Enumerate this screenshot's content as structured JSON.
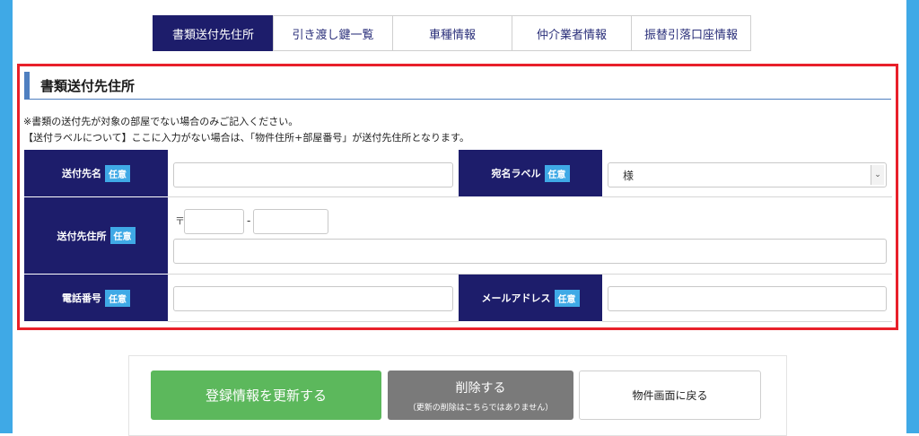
{
  "tabs": [
    {
      "label": "書類送付先住所"
    },
    {
      "label": "引き渡し鍵一覧"
    },
    {
      "label": "車種情報"
    },
    {
      "label": "仲介業者情報"
    },
    {
      "label": "振替引落口座情報"
    }
  ],
  "section": {
    "title": "書類送付先住所",
    "note1": "※書類の送付先が対象の部屋でない場合のみご記入ください。",
    "note2": "【送付ラベルについて】ここに入力がない場合は、「物件住所+部屋番号」が送付先住所となります。"
  },
  "form": {
    "optional_badge": "任意",
    "recipient_name_label": "送付先名",
    "recipient_name_value": "",
    "name_label_label": "宛名ラベル",
    "name_label_selected": "様",
    "address_label": "送付先住所",
    "postal_mark": "〒",
    "postal_dash": "-",
    "postal1_value": "",
    "postal2_value": "",
    "address_value": "",
    "phone_label": "電話番号",
    "phone_value": "",
    "email_label": "メールアドレス",
    "email_value": ""
  },
  "buttons": {
    "update": "登録情報を更新する",
    "delete": "削除する",
    "delete_sub": "（更新の削除はこちらではありません）",
    "back": "物件画面に戻る"
  },
  "colors": {
    "navy": "#1d1d6b",
    "badge_blue": "#3fa9e6",
    "highlight_red": "#e8202a",
    "update_green": "#5cb85c",
    "delete_gray": "#7a7a7a"
  }
}
